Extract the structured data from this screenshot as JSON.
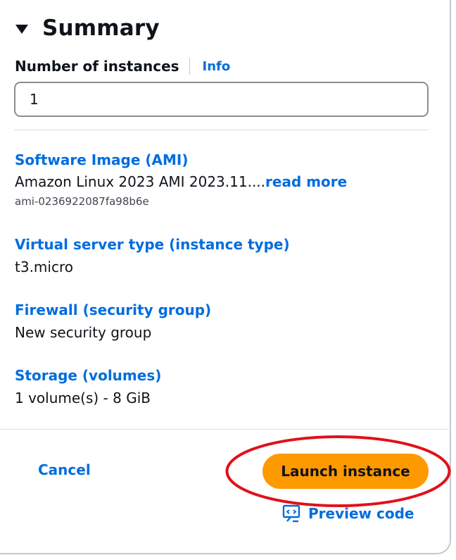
{
  "summary": {
    "title": "Summary",
    "instances_label": "Number of instances",
    "info_link": "Info",
    "instances_value": "1"
  },
  "sections": {
    "ami": {
      "title": "Software Image (AMI)",
      "value": "Amazon Linux 2023 AMI 2023.11....",
      "read_more": "read more",
      "ami_id": "ami-0236922087fa98b6e"
    },
    "instance_type": {
      "title": "Virtual server type (instance type)",
      "value": "t3.micro"
    },
    "firewall": {
      "title": "Firewall (security group)",
      "value": "New security group"
    },
    "storage": {
      "title": "Storage (volumes)",
      "value": "1 volume(s) - 8 GiB"
    }
  },
  "actions": {
    "cancel_label": "Cancel",
    "launch_label": "Launch instance",
    "preview_label": "Preview code"
  },
  "colors": {
    "link": "#006ce0",
    "primary_button": "#ff9900",
    "highlight": "#e0111b"
  },
  "icons": {
    "caret": "caret-down-icon",
    "preview": "code-preview-icon"
  }
}
